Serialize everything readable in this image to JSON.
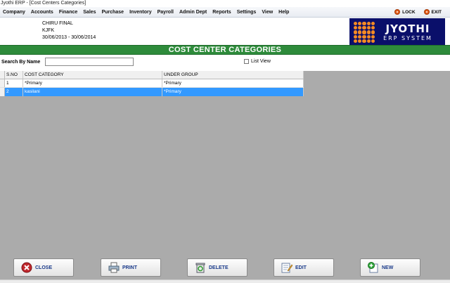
{
  "window": {
    "title": "Jyothi ERP - [Cost Centers Categories]"
  },
  "menu": {
    "items": [
      "Company",
      "Accounts",
      "Finance",
      "Sales",
      "Purchase",
      "Inventory",
      "Payroll",
      "Admin Dept",
      "Reports",
      "Settings",
      "View",
      "Help"
    ],
    "lock_label": "LOCK",
    "exit_label": "EXIT"
  },
  "company": {
    "name": "CHIRU FINAL",
    "code": "KJFK",
    "period": "30/06/2013 - 30/06/2014"
  },
  "logo": {
    "line1": "JYOTHI",
    "line2": "ERP SYSTEM"
  },
  "page": {
    "title": "COST CENTER CATEGORIES"
  },
  "search": {
    "label": "Search By Name",
    "value": "",
    "placeholder": ""
  },
  "list_view": {
    "label": "List View",
    "checked": false
  },
  "table": {
    "headers": {
      "sno": "S.NO",
      "category": "COST CATEGORY",
      "group": "UNDER GROUP"
    },
    "rows": [
      {
        "sno": "1",
        "category": "*Primary",
        "group": "*Primary",
        "selected": false
      },
      {
        "sno": "2",
        "category": "kasilani",
        "group": "*Primary",
        "selected": true
      }
    ]
  },
  "buttons": {
    "close": "CLOSE",
    "print": "PRINT",
    "delete": "DELETE",
    "edit": "EDIT",
    "new": "NEW"
  },
  "colors": {
    "banner": "#2e8b3b",
    "selection": "#3399ff",
    "workspace": "#ababab",
    "logo_bg": "#0a0f6a",
    "logo_accent": "#f48a24"
  }
}
